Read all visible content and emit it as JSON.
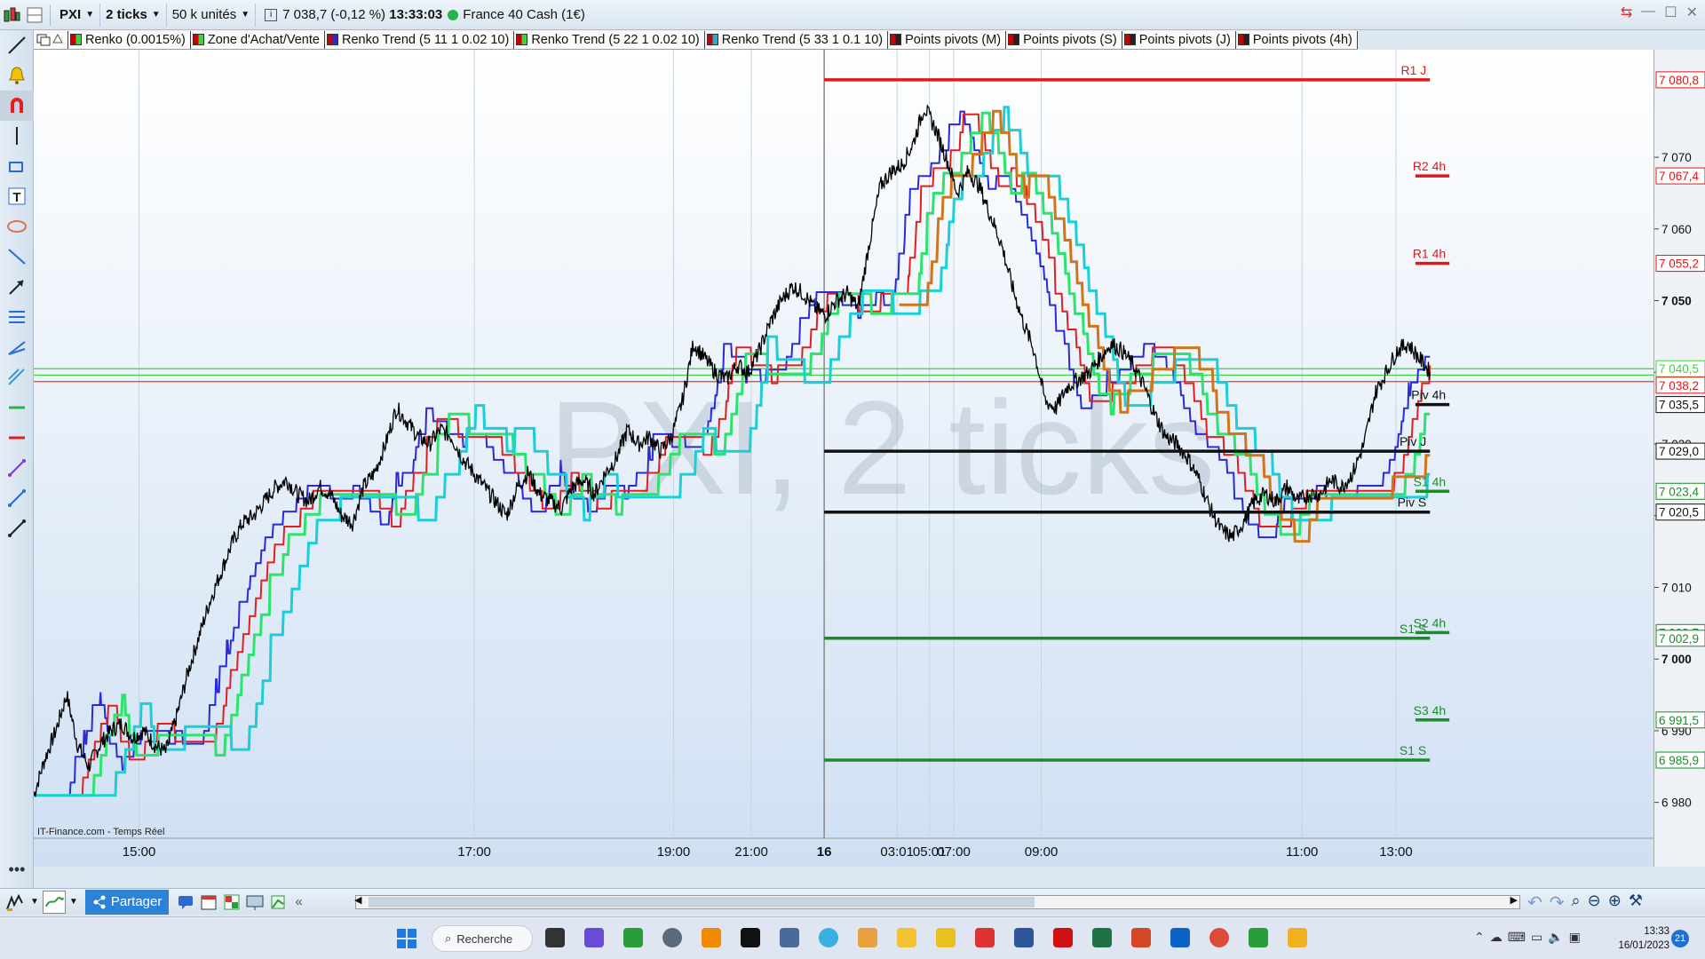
{
  "toolbar": {
    "symbol": "PXI",
    "interval": "2 ticks",
    "units": "50 k unités",
    "last_price": "7 038,7 (-0,12 %)",
    "time": "13:33:03",
    "instrument": "France 40 Cash (1€)"
  },
  "indicators": [
    {
      "label": "Renko (0.0015%)",
      "color": "#3fd13f"
    },
    {
      "label": "Zone d'Achat/Vente",
      "color": "#3fd13f"
    },
    {
      "label": "Renko Trend (5 11 1 0.02 10)",
      "color": "#2a2ad6"
    },
    {
      "label": "Renko Trend (5 22 1 0.02 10)",
      "color": "#3fd13f"
    },
    {
      "label": "Renko Trend (5 33 1 0.1 10)",
      "color": "#1fb0d6"
    },
    {
      "label": "Points pivots (M)",
      "color": "#222222"
    },
    {
      "label": "Points pivots (S)",
      "color": "#222222"
    },
    {
      "label": "Points pivots (J)",
      "color": "#222222"
    },
    {
      "label": "Points pivots (4h)",
      "color": "#222222"
    }
  ],
  "watermark": "PXI, 2 ticks",
  "source_label": "IT-Finance.com - Temps Réel",
  "bottom": {
    "share_label": "Partager"
  },
  "taskbar": {
    "search_label": "Recherche",
    "clock_time": "13:33",
    "clock_date": "16/01/2023",
    "badge": "21"
  },
  "chart_data": {
    "type": "line",
    "ylim": [
      6975,
      7085
    ],
    "x_ticks": [
      "15:00",
      "17:00",
      "19:00",
      "21:00",
      "16",
      "03:01",
      "05:01",
      "07:00",
      "09:00",
      "11:00",
      "13:00"
    ],
    "y_ticks": [
      "6 980",
      "6 990",
      "7 000",
      "7 010",
      "7 020",
      "7 030",
      "7 040",
      "7 050",
      "7 060",
      "7 070"
    ],
    "price_series": {
      "name": "",
      "color": "#000000",
      "values": [
        6981,
        6986,
        6990,
        6995,
        6988,
        6985,
        6988,
        6990,
        6991,
        6989,
        6990,
        6988,
        6987,
        6992,
        6998,
        7003,
        7008,
        7012,
        7016,
        7019,
        7020,
        7022,
        7024,
        7025,
        7023,
        7022,
        7024,
        7023,
        7020,
        7019,
        7024,
        7026,
        7030,
        7035,
        7033,
        7031,
        7030,
        7032,
        7031,
        7028,
        7026,
        7024,
        7022,
        7020,
        7024,
        7026,
        7023,
        7022,
        7021,
        7024,
        7025,
        7023,
        7026,
        7028,
        7032,
        7030,
        7031,
        7029,
        7031,
        7036,
        7044,
        7042,
        7040,
        7039,
        7041,
        7040,
        7043,
        7047,
        7050,
        7052,
        7051,
        7049,
        7048,
        7050,
        7051,
        7049,
        7058,
        7066,
        7068,
        7069,
        7072,
        7077,
        7074,
        7070,
        7065,
        7068,
        7066,
        7062,
        7058,
        7052,
        7047,
        7043,
        7036,
        7035,
        7038,
        7039,
        7040,
        7042,
        7044,
        7043,
        7041,
        7038,
        7034,
        7031,
        7030,
        7028,
        7025,
        7021,
        7018,
        7017,
        7019,
        7022,
        7023,
        7022,
        7024,
        7022,
        7023,
        7023,
        7025,
        7024,
        7026,
        7030,
        7037,
        7040,
        7043,
        7044,
        7042,
        7040
      ]
    },
    "renko_lines": [
      {
        "name": "",
        "color": "#2a2ad6",
        "width": 2,
        "lag": 3,
        "step": 1.8
      },
      {
        "name": "",
        "color": "#e02020",
        "width": 2,
        "lag": 4,
        "step": 2.5
      },
      {
        "name": "",
        "color": "#2de36d",
        "width": 3,
        "lag": 5,
        "step": 2.8
      },
      {
        "name": "",
        "color": "#1ccfd6",
        "width": 3,
        "lag": 7,
        "step": 3.2
      },
      {
        "name": "",
        "color": "#d0761a",
        "width": 3,
        "lag": 6,
        "step": 3.0,
        "from_frac": 0.62
      }
    ],
    "pivots": [
      {
        "label": "R1 J",
        "value": 7080.8,
        "color": "#e01818",
        "scope": "day"
      },
      {
        "label": "R2 4h",
        "value": 7067.4,
        "color": "#e01818",
        "scope": "4h"
      },
      {
        "label": "R1 4h",
        "value": 7055.2,
        "color": "#e01818",
        "scope": "4h"
      },
      {
        "label": "Piv 4h",
        "value": 7035.5,
        "color": "#111111",
        "scope": "4h"
      },
      {
        "label": "Piv J",
        "value": 7029.0,
        "color": "#111111",
        "scope": "day"
      },
      {
        "label": "S1 4h",
        "value": 7023.4,
        "color": "#1a8c2a",
        "scope": "4h"
      },
      {
        "label": "Piv S",
        "value": 7020.5,
        "color": "#111111",
        "scope": "day"
      },
      {
        "label": "S2 4h",
        "value": 7003.7,
        "color": "#1a8c2a",
        "scope": "4h"
      },
      {
        "label": "S1 S",
        "value": 7002.9,
        "color": "#1a8c2a",
        "scope": "day"
      },
      {
        "label": "S3 4h",
        "value": 6991.5,
        "color": "#1a8c2a",
        "scope": "4h"
      },
      {
        "label": "S1 S",
        "value": 6985.9,
        "color": "#1a8c2a",
        "scope": "day"
      }
    ],
    "price_tags": [
      {
        "text": "7 080,8",
        "value": 7080.8,
        "color": "#e01818"
      },
      {
        "text": "7 067,4",
        "value": 7067.4,
        "color": "#e01818"
      },
      {
        "text": "7 055,2",
        "value": 7055.2,
        "color": "#e01818"
      },
      {
        "text": "7 040,5",
        "value": 7040.5,
        "color": "#3fd13f"
      },
      {
        "text": "7 038,2",
        "value": 7038.2,
        "color": "#e01818"
      },
      {
        "text": "7 035,5",
        "value": 7035.5,
        "color": "#111111"
      },
      {
        "text": "7 029,0",
        "value": 7029.0,
        "color": "#111111"
      },
      {
        "text": "7 023,4",
        "value": 7023.4,
        "color": "#1a8c2a"
      },
      {
        "text": "7 020,5",
        "value": 7020.5,
        "color": "#111111"
      },
      {
        "text": "7 003,7",
        "value": 7003.7,
        "color": "#1a8c2a"
      },
      {
        "text": "7 002,9",
        "value": 7002.9,
        "color": "#1a8c2a"
      },
      {
        "text": "6 991,5",
        "value": 6991.5,
        "color": "#1a8c2a"
      },
      {
        "text": "6 985,9",
        "value": 6985.9,
        "color": "#1a8c2a"
      }
    ],
    "h_lines": [
      {
        "value": 7038.7,
        "color": "#c94a2a"
      },
      {
        "value": 7039.6,
        "color": "#3fd13f"
      },
      {
        "value": 7040.5,
        "color": "#3fd13f"
      }
    ],
    "grid": "vertical"
  }
}
